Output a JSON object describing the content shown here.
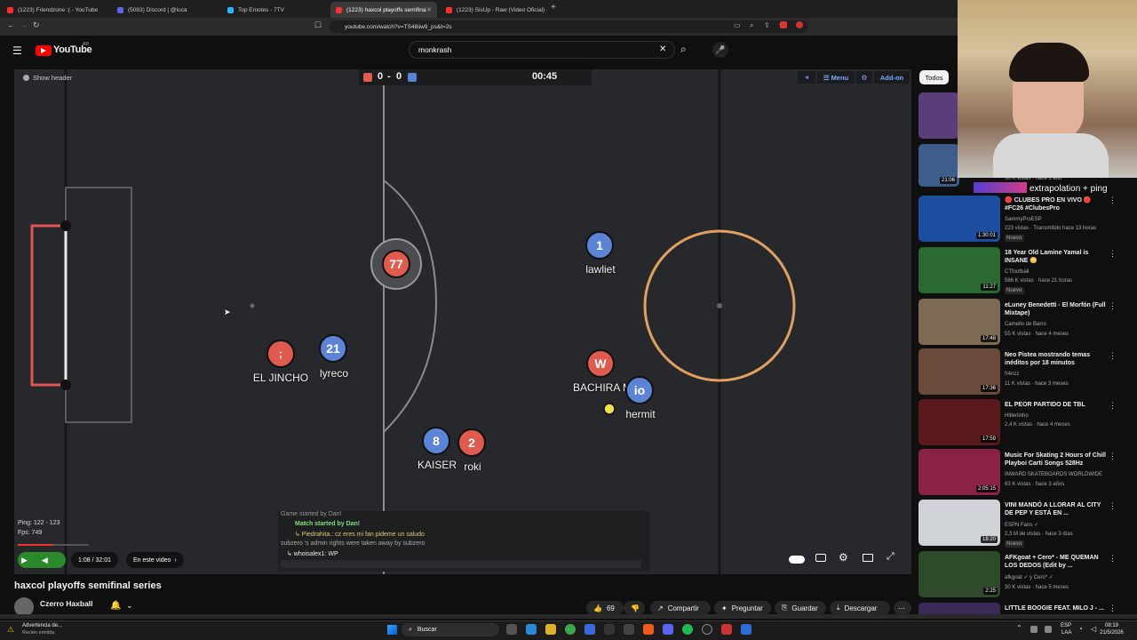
{
  "browser": {
    "tabs": [
      {
        "label": "(1223) Friendzone :( - YouTube",
        "color": "#ff2d2d"
      },
      {
        "label": "(5083) Discord | @luca",
        "color": "#5865f2"
      },
      {
        "label": "Top Emotes - 7TV",
        "color": "#29b6f6"
      },
      {
        "label": "(1223) haxcol playoffs semifinal",
        "color": "#ff2d2d"
      },
      {
        "label": "(1223) SisUp - Raw (Video Oficial) - Y",
        "color": "#ff2d2d"
      }
    ],
    "url": "youtube.com/watch?v=TS48iiw9_ps&t=2s"
  },
  "youtube": {
    "logo": "YouTube",
    "country": "AR",
    "search_value": "monkrash"
  },
  "video": {
    "show_header": "Show header",
    "score_left": "0",
    "score_sep": "-",
    "score_right": "0",
    "timer": "00:45",
    "menu_label": "Menu",
    "addon_label": "Add-on",
    "players": [
      {
        "num": "77",
        "team": "red",
        "name": ""
      },
      {
        "num": "1",
        "team": "blue",
        "name": "lawliet"
      },
      {
        "num": "",
        "team": "red",
        "name": "EL JINCHO"
      },
      {
        "num": "21",
        "team": "blue",
        "name": "lyreco"
      },
      {
        "num": "W",
        "team": "red",
        "name": "BACHIRA M"
      },
      {
        "num": "io",
        "team": "blue",
        "name": "hermit"
      },
      {
        "num": "8",
        "team": "blue",
        "name": "KAISER"
      },
      {
        "num": "2",
        "team": "red",
        "name": "roki"
      }
    ],
    "chat": [
      {
        "text": "Game started by Dan!",
        "color": "#bbbbbb"
      },
      {
        "text": "Match started by Dan!",
        "color": "#7fe07f"
      },
      {
        "text": "↳ Piedrahita.: cz eres mi fan pideme un saludo",
        "color": "#e7c76a"
      },
      {
        "text": "subzero 's admin rights were taken away by subzero",
        "color": "#bbbbbb"
      },
      {
        "text": "↳ whoisalex1: WP",
        "color": "#eeeeee"
      }
    ],
    "ping": "Ping: 122 - 123",
    "fps": "Fps: 749",
    "time_display": "1:08 / 32:01",
    "chapter_label": "En este video"
  },
  "below": {
    "title": "haxcol playoffs semifinal series",
    "channel": "Czerro Haxball",
    "likes": "69",
    "share": "Compartir",
    "ask": "Preguntar",
    "save": "Guardar",
    "download": "Descargar"
  },
  "sidebar": {
    "filter": "Todos",
    "overlay_text": "extrapolation + ping",
    "top_meta": "56 K vistas · hace 1 año",
    "top_duration": "21:06",
    "items": [
      {
        "title": "🔴 CLUBES PRO EN VIVO 🔴 #FC26 #ClubesPro",
        "channel": "SammyProESP",
        "meta": "223 vistas · Transmitido hace 13 horas",
        "badge": "Nuevo",
        "duration": "1:30:01",
        "bg": "#1d4d9e"
      },
      {
        "title": "18 Year Old Lamine Yamal is INSANE 😳",
        "channel": "CTfootball",
        "meta": "586 K vistas · hace 21 horas",
        "badge": "Nuevo",
        "duration": "11:27",
        "bg": "#2a6a32"
      },
      {
        "title": "eLuney Benedetti - El Morfón (Full Mixtape)",
        "channel": "Camello de Barro",
        "meta": "55 K vistas · hace 4 meses",
        "badge": "",
        "duration": "17:48",
        "bg": "#7c6a52"
      },
      {
        "title": "Neo Pistea mostrando temas inéditos por 18 minutos",
        "channel": "fr4nzz",
        "meta": "11 K vistas · hace 3 meses",
        "badge": "",
        "duration": "17:36",
        "bg": "#6a4a3a"
      },
      {
        "title": "EL PEOR PARTIDO DE TBL",
        "channel": "Hitlerlinho",
        "meta": "2,4 K vistas · hace 4 meses",
        "badge": "",
        "duration": "17:59",
        "bg": "#5a1a1c"
      },
      {
        "title": "Music For Skating 2 Hours of Chill Playboi Carti Songs 528Hz",
        "channel": "INWARD SKATEBOARDS WORLDWIDE",
        "meta": "63 K vistas · hace 3 años",
        "badge": "",
        "duration": "2:05:15",
        "bg": "#8a2244"
      },
      {
        "title": "VINI MANDÓ A LLORAR AL CITY DE PEP Y ESTÁ EN ...",
        "channel": "ESPN Fans ✓",
        "meta": "2,3 M de vistas · hace 3 días",
        "badge": "Nuevo",
        "duration": "18:20",
        "bg": "#cfd2d6"
      },
      {
        "title": "AFKgoat + Cero* - ME QUEMAN LOS DEDOS (Edit by ...",
        "channel": "afkgoat ✓ y Cero* ✓",
        "meta": "30 K vistas · hace 5 meses",
        "badge": "",
        "duration": "2:25",
        "bg": "#2e4a2a"
      },
      {
        "title": "LITTLE BOOGIE FEAT. MILO J - ...",
        "channel": "",
        "meta": "",
        "badge": "",
        "duration": "",
        "bg": "#3a2a5a"
      }
    ]
  },
  "taskbar": {
    "notif_title": "Advertencia de...",
    "notif_sub": "Recién emitida",
    "search": "Buscar",
    "lang1": "ESP",
    "lang2": "LAA",
    "time": "08:19",
    "date": "21/5/2026"
  }
}
